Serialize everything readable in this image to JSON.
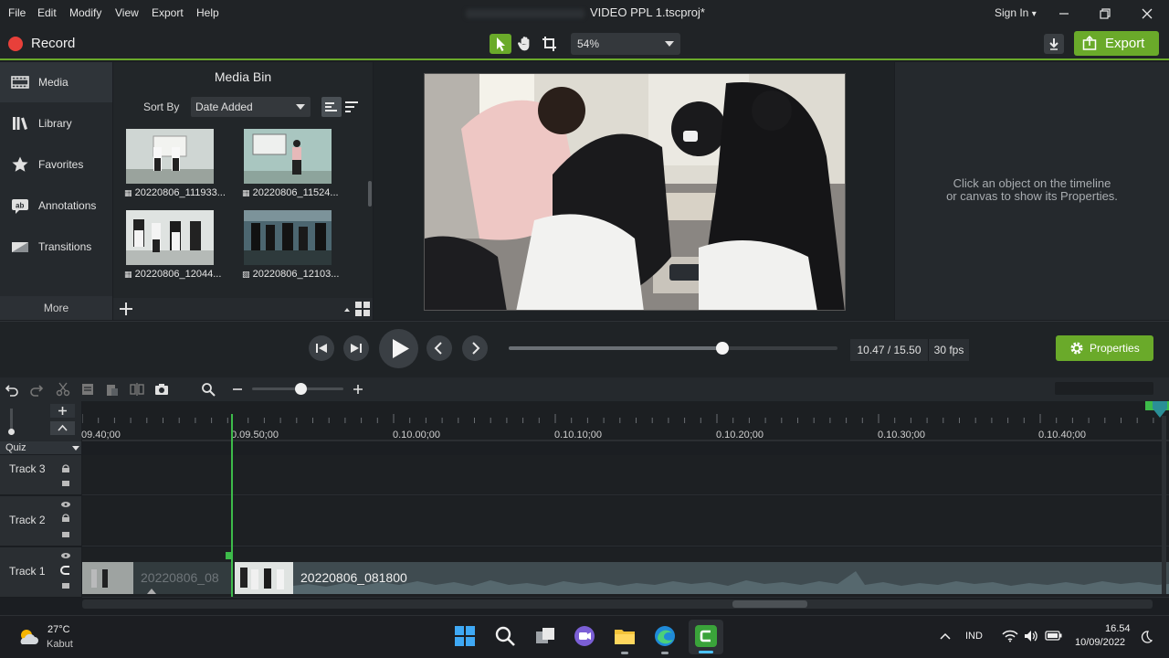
{
  "menu": [
    "File",
    "Edit",
    "Modify",
    "View",
    "Export",
    "Help"
  ],
  "window": {
    "title": "VIDEO PPL 1.tscproj*",
    "signin": "Sign In",
    "signin_caret": "▾"
  },
  "toolbar": {
    "record_label": "Record",
    "zoom_value": "54%",
    "export_label": "Export"
  },
  "leftnav": {
    "items": [
      "Media",
      "Library",
      "Favorites",
      "Annotations",
      "Transitions"
    ],
    "more_label": "More"
  },
  "mediabin": {
    "title": "Media Bin",
    "sort_label": "Sort By",
    "sort_value": "Date Added",
    "items": [
      "20220806_111933...",
      "20220806_11524...",
      "20220806_12044...",
      "20220806_12103..."
    ]
  },
  "properties": {
    "hint_line1": "Click an object on the timeline",
    "hint_line2": "or canvas to show its Properties."
  },
  "playback": {
    "time": "10.47 / 15.50",
    "fps": "30 fps",
    "properties_label": "Properties",
    "progress": 0.65
  },
  "timeline": {
    "ticks": [
      "09.40;00",
      "0.09.50;00",
      "0.10.00;00",
      "0.10.10;00",
      "0.10.20;00",
      "0.10.30;00",
      "0.10.40;00"
    ],
    "quiz_label": "Quiz",
    "tracks": [
      "Track 3",
      "Track 2",
      "Track 1"
    ],
    "clips": [
      "20220806_08",
      "20220806_081800"
    ]
  },
  "taskbar": {
    "temp": "27°C",
    "weather": "Kabut",
    "lang": "IND",
    "time": "16.54",
    "date": "10/09/2022"
  }
}
